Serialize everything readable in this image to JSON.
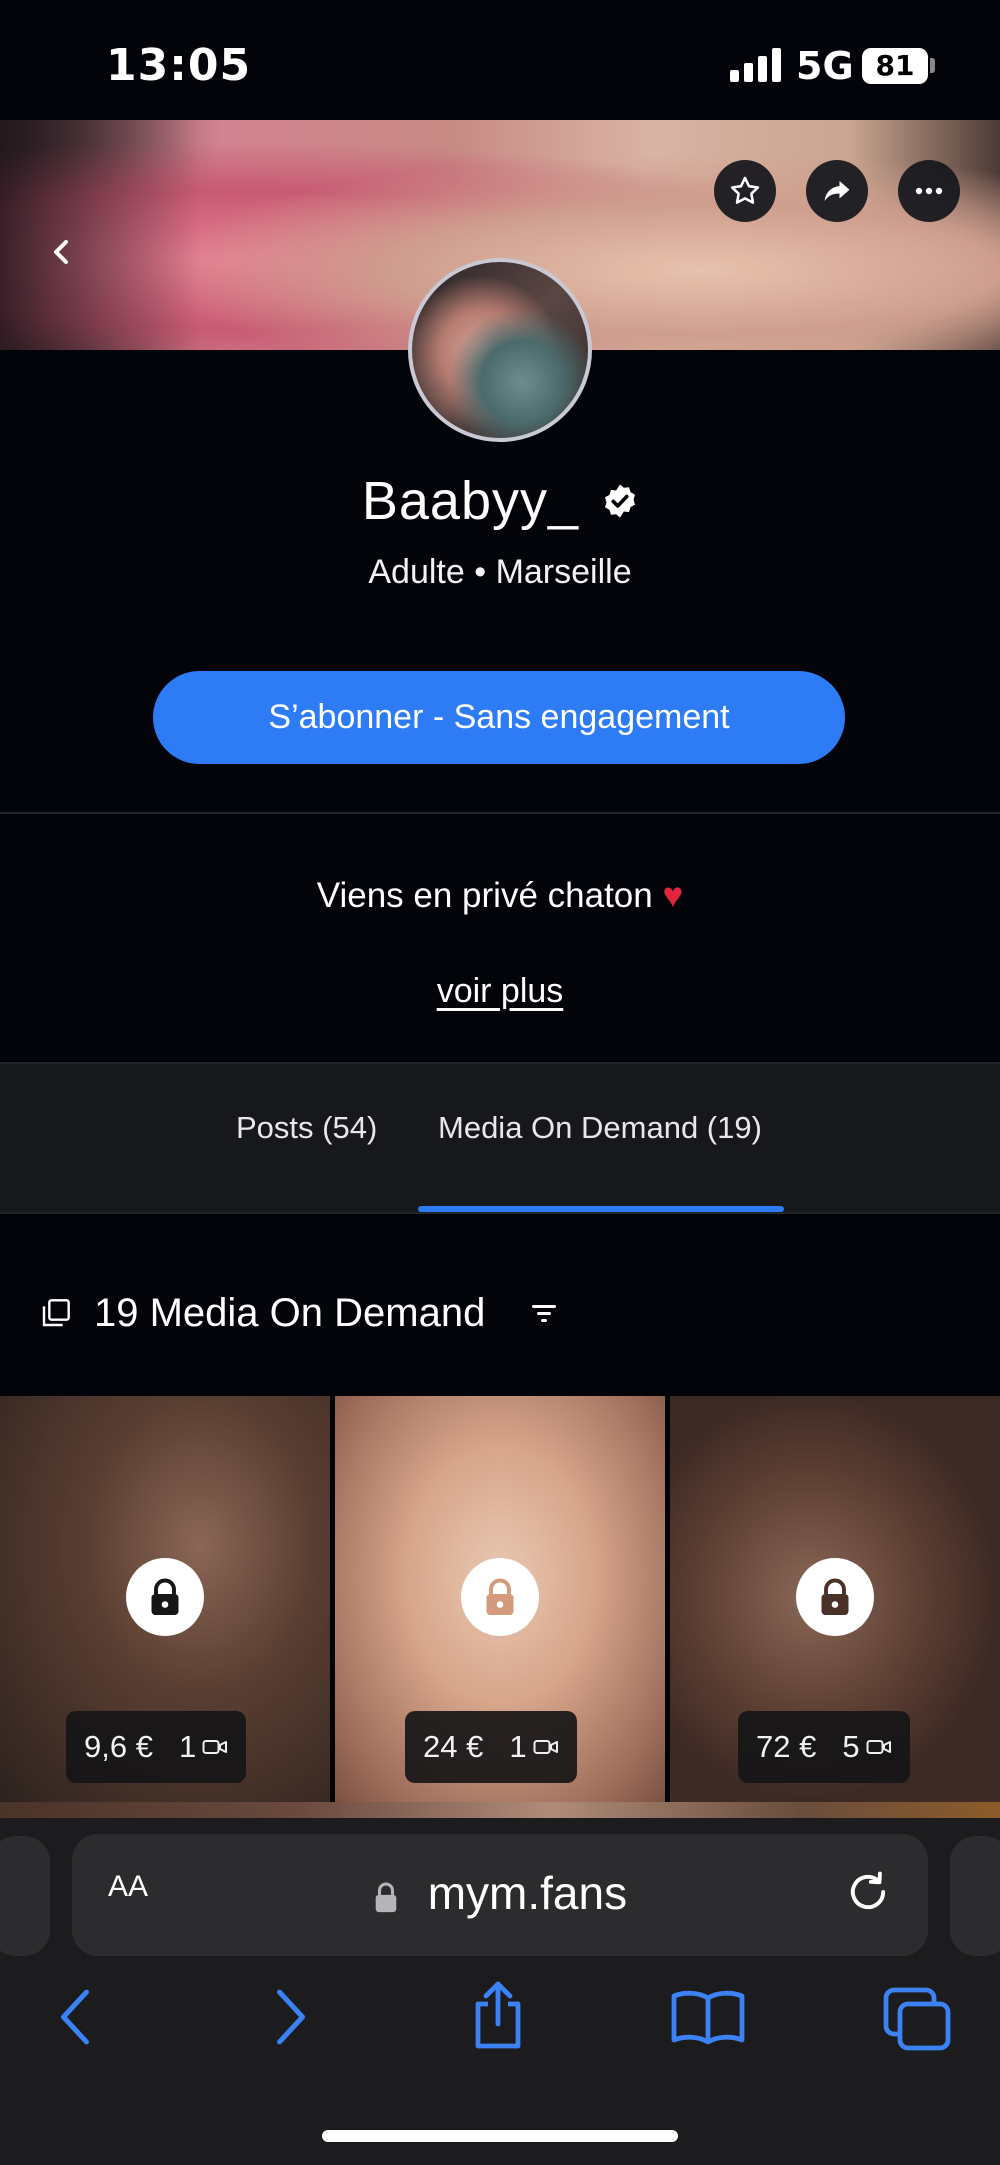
{
  "status_bar": {
    "time": "13:05",
    "network": "5G",
    "battery": "81"
  },
  "profile": {
    "name": "Baabyy_",
    "subtitle": "Adulte • Marseille",
    "subscribe_label": "S’abonner - Sans engagement",
    "bio": "Viens en privé chaton",
    "bio_emoji": "♥",
    "see_more_label": "voir plus"
  },
  "tabs": [
    {
      "label": "Posts (54)",
      "active": false
    },
    {
      "label": "Media On Demand (19)",
      "active": true
    }
  ],
  "section": {
    "title": "19 Media On Demand"
  },
  "media_items": [
    {
      "price": "9,6 €",
      "count": "1",
      "locked": true
    },
    {
      "price": "24 €",
      "count": "1",
      "locked": true
    },
    {
      "price": "72 €",
      "count": "5",
      "locked": true
    }
  ],
  "browser": {
    "text_size_label": "AA",
    "url": "mym.fans"
  },
  "colors": {
    "accent": "#2d7cf6",
    "background": "#03040a",
    "tab_bg": "#17181c"
  }
}
